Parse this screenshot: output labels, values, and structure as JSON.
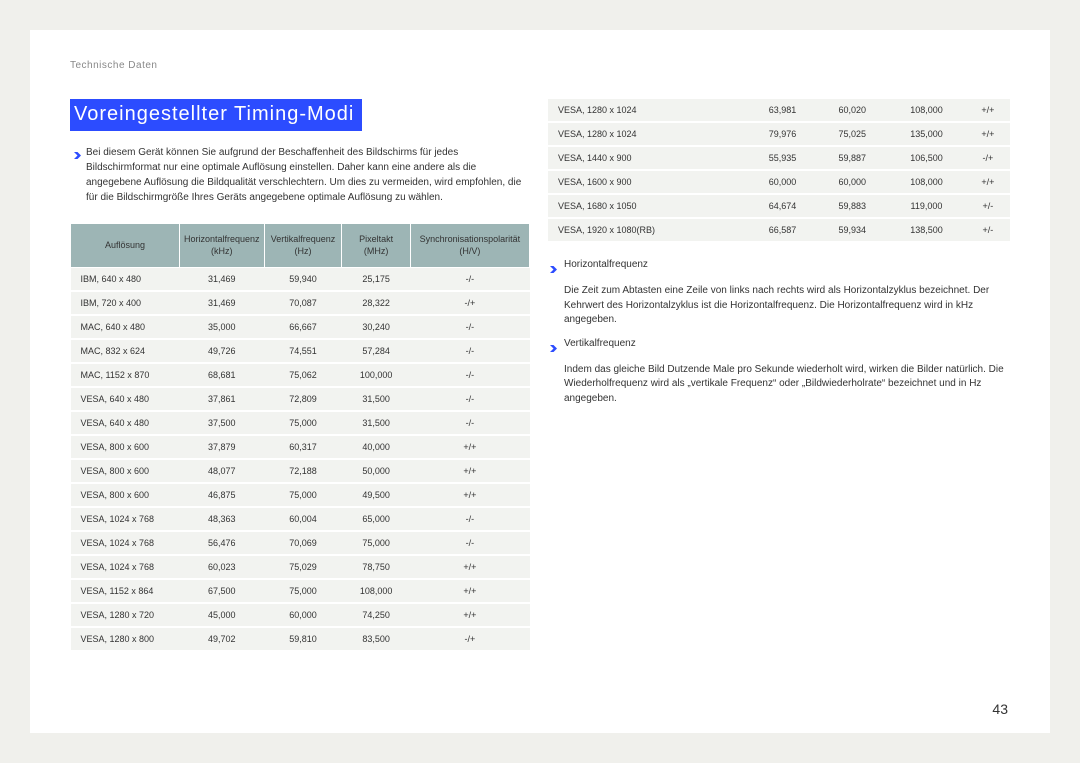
{
  "breadcrumb": "Technische Daten",
  "title": "Voreingestellter Timing-Modi",
  "intro": "Bei diesem Gerät können Sie aufgrund der Beschaffenheit des Bildschirms für jedes Bildschirmformat nur eine optimale Auflösung einstellen. Daher kann eine andere als die angegebene Auflösung die Bildqualität verschlechtern. Um dies zu vermeiden, wird empfohlen, die für die Bildschirmgröße Ihres Geräts angegebene optimale Auflösung zu wählen.",
  "headers": {
    "res": "Auflösung",
    "h": "Horizontalfrequenz",
    "h_unit": "(kHz)",
    "v": "Vertikalfrequenz",
    "v_unit": "(Hz)",
    "clk": "Pixeltakt",
    "clk_unit": "(MHz)",
    "pol": "Synchronisationspolarität",
    "pol_unit": "(H/V)"
  },
  "rows_left": [
    [
      "IBM, 640 x 480",
      "31,469",
      "59,940",
      "25,175",
      "-/-"
    ],
    [
      "IBM, 720 x 400",
      "31,469",
      "70,087",
      "28,322",
      "-/+"
    ],
    [
      "MAC, 640 x 480",
      "35,000",
      "66,667",
      "30,240",
      "-/-"
    ],
    [
      "MAC, 832 x 624",
      "49,726",
      "74,551",
      "57,284",
      "-/-"
    ],
    [
      "MAC, 1152 x 870",
      "68,681",
      "75,062",
      "100,000",
      "-/-"
    ],
    [
      "VESA, 640 x 480",
      "37,861",
      "72,809",
      "31,500",
      "-/-"
    ],
    [
      "VESA, 640 x 480",
      "37,500",
      "75,000",
      "31,500",
      "-/-"
    ],
    [
      "VESA, 800 x 600",
      "37,879",
      "60,317",
      "40,000",
      "+/+"
    ],
    [
      "VESA, 800 x 600",
      "48,077",
      "72,188",
      "50,000",
      "+/+"
    ],
    [
      "VESA, 800 x 600",
      "46,875",
      "75,000",
      "49,500",
      "+/+"
    ],
    [
      "VESA, 1024 x 768",
      "48,363",
      "60,004",
      "65,000",
      "-/-"
    ],
    [
      "VESA, 1024 x 768",
      "56,476",
      "70,069",
      "75,000",
      "-/-"
    ],
    [
      "VESA, 1024 x 768",
      "60,023",
      "75,029",
      "78,750",
      "+/+"
    ],
    [
      "VESA, 1152 x 864",
      "67,500",
      "75,000",
      "108,000",
      "+/+"
    ],
    [
      "VESA, 1280 x 720",
      "45,000",
      "60,000",
      "74,250",
      "+/+"
    ],
    [
      "VESA, 1280 x 800",
      "49,702",
      "59,810",
      "83,500",
      "-/+"
    ]
  ],
  "rows_right": [
    [
      "VESA, 1280 x 1024",
      "63,981",
      "60,020",
      "108,000",
      "+/+"
    ],
    [
      "VESA, 1280 x 1024",
      "79,976",
      "75,025",
      "135,000",
      "+/+"
    ],
    [
      "VESA, 1440 x 900",
      "55,935",
      "59,887",
      "106,500",
      "-/+"
    ],
    [
      "VESA, 1600 x 900",
      "60,000",
      "60,000",
      "108,000",
      "+/+"
    ],
    [
      "VESA, 1680 x 1050",
      "64,674",
      "59,883",
      "119,000",
      "+/-"
    ],
    [
      "VESA, 1920 x 1080(RB)",
      "66,587",
      "59,934",
      "138,500",
      "+/-"
    ]
  ],
  "defs": [
    {
      "title": "Horizontalfrequenz",
      "text": "Die Zeit zum Abtasten eine Zeile von links nach rechts wird als Horizontalzyklus bezeichnet. Der Kehrwert des Horizontalzyklus ist die Horizontalfrequenz. Die Horizontalfrequenz wird in kHz angegeben."
    },
    {
      "title": "Vertikalfrequenz",
      "text": "Indem das gleiche Bild Dutzende Male pro Sekunde wiederholt wird, wirken die Bilder natürlich. Die Wiederholfrequenz wird als „vertikale Frequenz“ oder „Bildwiederholrate“ bezeichnet und in Hz angegeben."
    }
  ],
  "page_number": "43"
}
